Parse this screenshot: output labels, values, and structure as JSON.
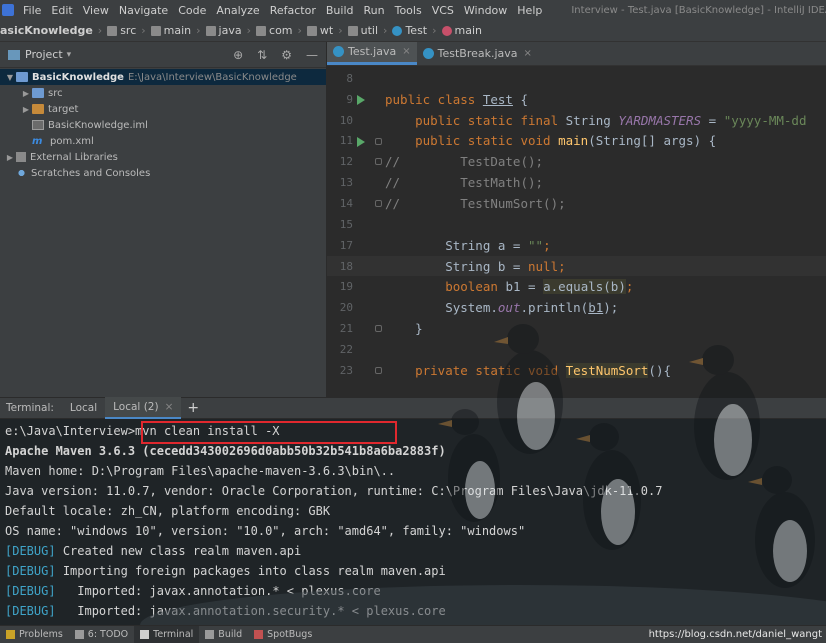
{
  "app_icon": "intellij-icon",
  "menu": [
    "File",
    "Edit",
    "View",
    "Navigate",
    "Code",
    "Analyze",
    "Refactor",
    "Build",
    "Run",
    "Tools",
    "VCS",
    "Window",
    "Help"
  ],
  "window_title": "Interview - Test.java [BasicKnowledge] - IntelliJ IDEA",
  "breadcrumbs": [
    "asicKnowledge",
    "src",
    "main",
    "java",
    "com",
    "wt",
    "util",
    "Test",
    "main"
  ],
  "project_panel": {
    "title": "Project",
    "tree": [
      {
        "name": "BasicKnowledge",
        "path": "E:\\Java\\Interview\\BasicKnowledge",
        "level": 0,
        "arrow": "▼",
        "icon": "folder-blue",
        "bold": true,
        "selected": true
      },
      {
        "name": "src",
        "level": 1,
        "arrow": "▶",
        "icon": "folder-blue"
      },
      {
        "name": "target",
        "level": 1,
        "arrow": "▶",
        "icon": "folder-orange"
      },
      {
        "name": "BasicKnowledge.iml",
        "level": 1,
        "arrow": "",
        "icon": "iml"
      },
      {
        "name": "pom.xml",
        "level": 1,
        "arrow": "",
        "icon": "maven"
      },
      {
        "name": "External Libraries",
        "level": 0,
        "arrow": "▶",
        "icon": "lib"
      },
      {
        "name": "Scratches and Consoles",
        "level": 0,
        "arrow": "",
        "icon": "scratch"
      }
    ]
  },
  "editor": {
    "tabs": [
      {
        "label": "Test.java",
        "active": true
      },
      {
        "label": "TestBreak.java",
        "active": false
      }
    ],
    "current_line": 18,
    "lines": [
      {
        "n": "8",
        "run": false,
        "fold": false,
        "segs": []
      },
      {
        "n": "9",
        "run": true,
        "fold": false,
        "segs": [
          [
            "kw",
            "public class "
          ],
          [
            "tx un",
            "Test"
          ],
          [
            "tx",
            " {"
          ]
        ]
      },
      {
        "n": "10",
        "run": false,
        "fold": false,
        "segs": [
          [
            "tx",
            "    "
          ],
          [
            "kw",
            "public static final "
          ],
          [
            "tx",
            "String "
          ],
          [
            "fi",
            "YARDMASTERS"
          ],
          [
            "tx",
            " = "
          ],
          [
            "st",
            "\"yyyy-MM-dd"
          ]
        ]
      },
      {
        "n": "11",
        "run": true,
        "fold": true,
        "segs": [
          [
            "tx",
            "    "
          ],
          [
            "kw",
            "public static void "
          ],
          [
            "fn",
            "main"
          ],
          [
            "tx",
            "(String[] args) {"
          ]
        ]
      },
      {
        "n": "12",
        "run": false,
        "fold": true,
        "segs": [
          [
            "cm",
            "//        TestDate();"
          ]
        ]
      },
      {
        "n": "13",
        "run": false,
        "fold": false,
        "segs": [
          [
            "cm",
            "//        TestMath();"
          ]
        ]
      },
      {
        "n": "14",
        "run": false,
        "fold": true,
        "segs": [
          [
            "cm",
            "//        TestNumSort();"
          ]
        ]
      },
      {
        "n": "15",
        "run": false,
        "fold": false,
        "segs": []
      },
      {
        "n": "17",
        "run": false,
        "fold": false,
        "segs": [
          [
            "tx",
            "        String a = "
          ],
          [
            "st",
            "\"\""
          ],
          [
            "kw",
            ";"
          ]
        ]
      },
      {
        "n": "18",
        "run": false,
        "fold": false,
        "segs": [
          [
            "tx",
            "        String b = "
          ],
          [
            "kw",
            "null"
          ],
          [
            "kw",
            ";"
          ]
        ]
      },
      {
        "n": "19",
        "run": false,
        "fold": false,
        "segs": [
          [
            "tx",
            "        "
          ],
          [
            "kw",
            "boolean "
          ],
          [
            "tx",
            "b1 = "
          ],
          [
            "tx hl",
            "a.equals(b)"
          ],
          [
            "kw",
            ";"
          ]
        ]
      },
      {
        "n": "20",
        "run": false,
        "fold": false,
        "segs": [
          [
            "tx",
            "        System."
          ],
          [
            "fi",
            "out"
          ],
          [
            "tx",
            ".println("
          ],
          [
            "tx un",
            "b1"
          ],
          [
            "tx",
            ");"
          ]
        ]
      },
      {
        "n": "21",
        "run": false,
        "fold": true,
        "segs": [
          [
            "tx",
            "    }"
          ]
        ]
      },
      {
        "n": "22",
        "run": false,
        "fold": false,
        "segs": []
      },
      {
        "n": "23",
        "run": false,
        "fold": true,
        "segs": [
          [
            "tx",
            "    "
          ],
          [
            "kw",
            "private static void "
          ],
          [
            "fn hl",
            "TestNumSort"
          ],
          [
            "tx",
            "(){"
          ]
        ]
      }
    ]
  },
  "terminal": {
    "label": "Terminal:",
    "tabs": [
      {
        "label": "Local",
        "active": false,
        "closable": false
      },
      {
        "label": "Local (2)",
        "active": true,
        "closable": true
      }
    ],
    "lines": [
      {
        "text": "e:\\Java\\Interview>mvn clean install -X",
        "bold": false,
        "debug": false
      },
      {
        "text": "Apache Maven 3.6.3 (cecedd343002696d0abb50b32b541b8a6ba2883f)",
        "bold": true,
        "debug": false
      },
      {
        "text": "Maven home: D:\\Program Files\\apache-maven-3.6.3\\bin\\..",
        "bold": false,
        "debug": false
      },
      {
        "text": "Java version: 11.0.7, vendor: Oracle Corporation, runtime: C:\\Program Files\\Java\\jdk-11.0.7",
        "bold": false,
        "debug": false
      },
      {
        "text": "Default locale: zh_CN, platform encoding: GBK",
        "bold": false,
        "debug": false
      },
      {
        "text": "OS name: \"windows 10\", version: \"10.0\", arch: \"amd64\", family: \"windows\"",
        "bold": false,
        "debug": false
      },
      {
        "text": "Created new class realm maven.api",
        "bold": false,
        "debug": true
      },
      {
        "text": "Importing foreign packages into class realm maven.api",
        "bold": false,
        "debug": true
      },
      {
        "text": "  Imported: javax.annotation.* < plexus.core",
        "bold": false,
        "debug": true
      },
      {
        "text": "  Imported: javax.annotation.security.* < plexus.core",
        "bold": false,
        "debug": true
      }
    ],
    "debug_tag": "[DEBUG]"
  },
  "status_bar": {
    "items": [
      {
        "label": "Problems",
        "icon": "warning-icon",
        "active": false
      },
      {
        "label": "6: TODO",
        "icon": "list-icon",
        "active": false
      },
      {
        "label": "Terminal",
        "icon": "terminal-icon",
        "active": true
      },
      {
        "label": "Build",
        "icon": "hammer-icon",
        "active": false
      },
      {
        "label": "SpotBugs",
        "icon": "bug-icon",
        "active": false
      }
    ],
    "url": "https://blog.csdn.net/daniel_wangt"
  }
}
